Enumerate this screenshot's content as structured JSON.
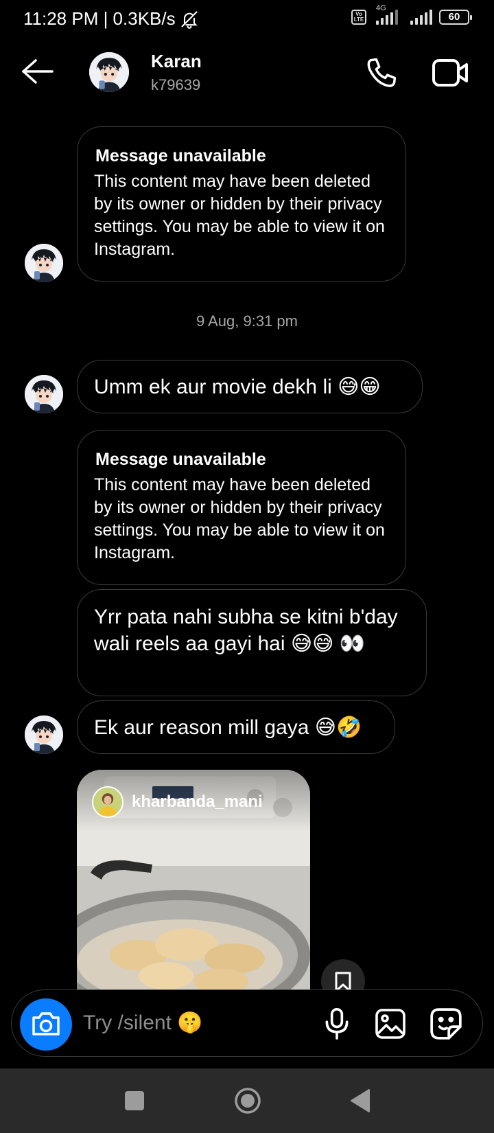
{
  "status_bar": {
    "time_speed": "11:28 PM | 0.3KB/s",
    "network": "4G",
    "volte": "Vo LTE",
    "battery": "60"
  },
  "header": {
    "name": "Karan",
    "username": "k79639"
  },
  "messages": {
    "unavailable_1": {
      "title": "Message unavailable",
      "body": "This content may have been deleted by its owner or hidden by their privacy settings. You may be able to view it on Instagram."
    },
    "timestamp": "9 Aug, 9:31 pm",
    "msg_1": "Umm ek aur movie dekh li 😅😁",
    "unavailable_2": {
      "title": "Message unavailable",
      "body": "This content may have been deleted by its owner or hidden by their privacy settings. You may be able to view it on Instagram."
    },
    "msg_2": "Yrr pata nahi subha se kitni b'day wali reels aa gayi hai 😅😅 👀",
    "msg_3": "Ek aur reason mill gaya 😅🤣",
    "reel": {
      "author": "kharbanda_mani"
    }
  },
  "composer": {
    "placeholder": "Try /silent 🤫"
  },
  "icons": {
    "back": "arrow-left-icon",
    "call": "phone-icon",
    "video": "video-camera-icon",
    "camera": "camera-icon",
    "mic": "microphone-icon",
    "gallery": "image-icon",
    "sticker": "sticker-icon",
    "save": "bookmark-icon",
    "mute": "bell-off-icon"
  },
  "colors": {
    "background": "#000000",
    "accent": "#0a7cff",
    "bubble_border": "#3a3a3a",
    "secondary_text": "#a8a8a8",
    "navbar": "#2a2a2a"
  }
}
